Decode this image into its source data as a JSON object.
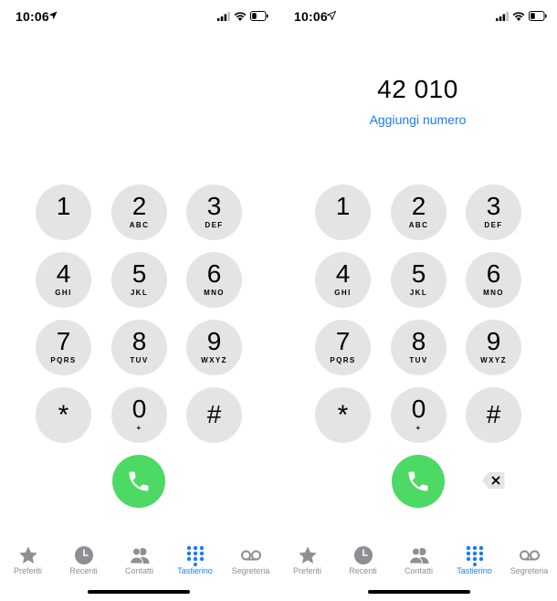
{
  "colors": {
    "accent": "#1a7cf5",
    "call_green": "#4cd964",
    "key_gray": "#e4e4e6",
    "tab_inactive": "#8e8e93"
  },
  "left": {
    "status": {
      "time": "10:06"
    },
    "keys": [
      {
        "digit": "1",
        "letters": ""
      },
      {
        "digit": "2",
        "letters": "ABC"
      },
      {
        "digit": "3",
        "letters": "DEF"
      },
      {
        "digit": "4",
        "letters": "GHI"
      },
      {
        "digit": "5",
        "letters": "JKL"
      },
      {
        "digit": "6",
        "letters": "MNO"
      },
      {
        "digit": "7",
        "letters": "PQRS"
      },
      {
        "digit": "8",
        "letters": "TUV"
      },
      {
        "digit": "9",
        "letters": "WXYZ"
      },
      {
        "digit": "*",
        "letters": ""
      },
      {
        "digit": "0",
        "letters": "+"
      },
      {
        "digit": "#",
        "letters": ""
      }
    ],
    "tabs": [
      {
        "label": "Preferiti",
        "icon": "star-icon"
      },
      {
        "label": "Recenti",
        "icon": "clock-icon"
      },
      {
        "label": "Contatti",
        "icon": "contacts-icon"
      },
      {
        "label": "Tastierino",
        "icon": "keypad-icon",
        "active": true
      },
      {
        "label": "Segreteria",
        "icon": "voicemail-icon"
      }
    ]
  },
  "right": {
    "status": {
      "time": "10:06"
    },
    "dialed_number": "42 010",
    "add_number_label": "Aggiungi numero",
    "keys": [
      {
        "digit": "1",
        "letters": ""
      },
      {
        "digit": "2",
        "letters": "ABC"
      },
      {
        "digit": "3",
        "letters": "DEF"
      },
      {
        "digit": "4",
        "letters": "GHI"
      },
      {
        "digit": "5",
        "letters": "JKL"
      },
      {
        "digit": "6",
        "letters": "MNO"
      },
      {
        "digit": "7",
        "letters": "PQRS"
      },
      {
        "digit": "8",
        "letters": "TUV"
      },
      {
        "digit": "9",
        "letters": "WXYZ"
      },
      {
        "digit": "*",
        "letters": ""
      },
      {
        "digit": "0",
        "letters": "+"
      },
      {
        "digit": "#",
        "letters": ""
      }
    ],
    "tabs": [
      {
        "label": "Preferiti",
        "icon": "star-icon"
      },
      {
        "label": "Recenti",
        "icon": "clock-icon"
      },
      {
        "label": "Contatti",
        "icon": "contacts-icon"
      },
      {
        "label": "Tastierino",
        "icon": "keypad-icon",
        "active": true
      },
      {
        "label": "Segreteria",
        "icon": "voicemail-icon"
      }
    ]
  }
}
